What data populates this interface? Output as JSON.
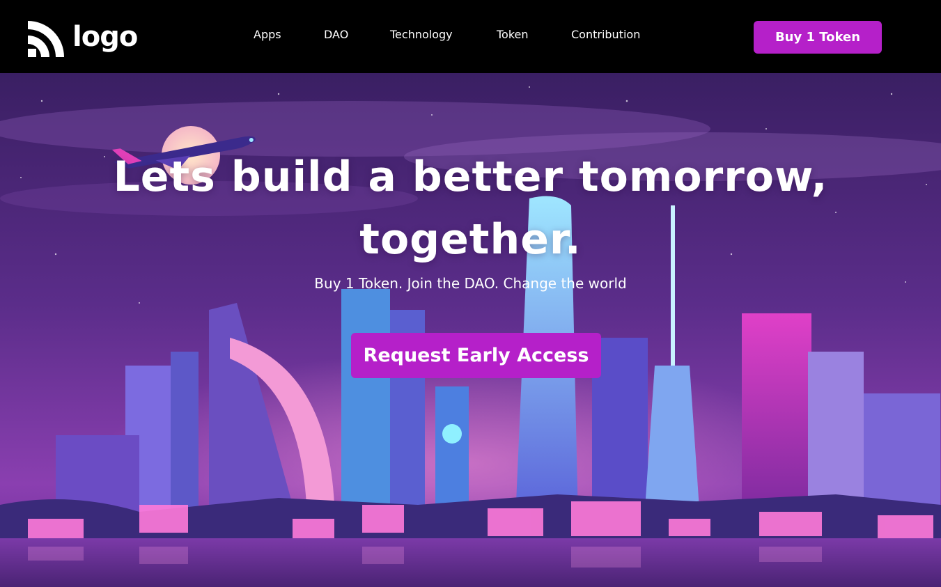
{
  "header": {
    "logo_text": "logo",
    "nav": [
      {
        "label": "Apps"
      },
      {
        "label": "DAO"
      },
      {
        "label": "Technology"
      },
      {
        "label": "Token"
      },
      {
        "label": "Contribution"
      }
    ],
    "cta_label": "Buy 1 Token"
  },
  "hero": {
    "title_line1": "Lets build a better tomorrow,",
    "title_line2": "together.",
    "subtitle": "Buy 1 Token. Join the DAO. Change the world",
    "cta_label": "Request Early Access"
  },
  "colors": {
    "accent": "#b520c9",
    "header_bg": "#000000",
    "sky_top": "#3a1f63",
    "sky_bottom": "#8a3fb0"
  },
  "icons": {
    "logo": "rss-style-logo-icon",
    "background": "neon-city-skyline-illustration"
  }
}
